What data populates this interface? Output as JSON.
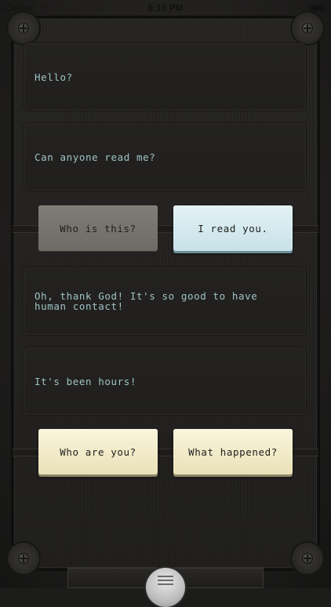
{
  "status_bar": {
    "carrier": "Carrier",
    "time": "6:15 PM"
  },
  "conversation": {
    "messages": [
      {
        "text": "Hello?"
      },
      {
        "text": "Can anyone read me?"
      },
      {
        "text": "Oh, thank God! It's so good to have human contact!"
      },
      {
        "text": "It's been hours!"
      }
    ],
    "choices_1": [
      {
        "label": "Who is this?"
      },
      {
        "label": "I read you."
      }
    ],
    "choices_2": [
      {
        "label": "Who are you?"
      },
      {
        "label": "What happened?"
      }
    ]
  },
  "icons": {
    "wifi": "wifi-icon",
    "battery": "battery-icon",
    "menu": "menu-icon",
    "screw": "screw-icon"
  }
}
